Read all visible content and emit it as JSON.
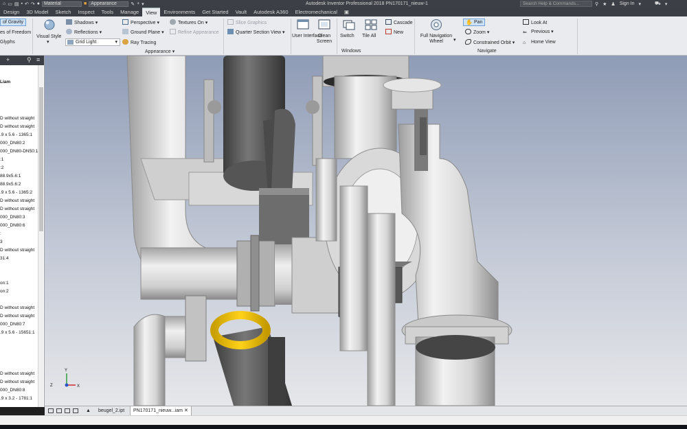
{
  "titlebar": {
    "quickaccess_combo1": "Material",
    "quickaccess_combo2": "Appearance",
    "title": "Autodesk Inventor Professional 2018    PN170171_nieuw-1",
    "search_placeholder": "Search Help & Commands...",
    "sign_in": "Sign In"
  },
  "tabs": [
    "Design",
    "3D Model",
    "Sketch",
    "Inspect",
    "Tools",
    "Manage",
    "View",
    "Environments",
    "Get Started",
    "Vault",
    "Autodesk A360",
    "Electromechanical"
  ],
  "active_tab": "View",
  "ribbon": {
    "visibility": {
      "center_of_gravity": "of Gravity",
      "dof": "es of Freedom",
      "glyphs": "Glyphs"
    },
    "appearance": {
      "visual_style": "Visual Style",
      "shadows": "Shadows",
      "reflections": "Reflections",
      "grid_light": "Grid Light",
      "perspective": "Perspective",
      "ground_plane": "Ground Plane",
      "ray_tracing": "Ray Tracing",
      "textures_on": "Textures On",
      "refine_appearance": "Refine Appearance",
      "slice_graphics": "Slice Graphics",
      "quarter_section_view": "Quarter Section View",
      "panel_label": "Appearance"
    },
    "windows": {
      "user_interface": "User Interface",
      "clean_screen": "Clean Screen",
      "switch": "Switch",
      "tile_all": "Tile All",
      "cascade": "Cascade",
      "new": "New",
      "panel_label": "Windows"
    },
    "navigate": {
      "full_navigation_wheel": "Full Navigation Wheel",
      "pan": "Pan",
      "zoom": "Zoom",
      "constrained_orbit": "Constrained Orbit",
      "look_at": "Look At",
      "previous": "Previous",
      "home_view": "Home View",
      "panel_label": "Navigate"
    }
  },
  "browser": {
    "root": "Liam",
    "rows": [
      "D without straight",
      "D without straight",
      ".9 x 5.6 - 1365:1",
      "000_DN80:2",
      "000_DN80-DN50:1",
      ":1",
      ":2",
      "88.9x5.6:1",
      "88.9x5.6:2",
      ".9 x 5.6 - 1365:2",
      "D without straight",
      "D without straight",
      "000_DN80:3",
      "000_DN80:6",
      ":",
      "3",
      "D without straight",
      "31:4",
      "",
      "",
      "on:1",
      "on:2",
      "",
      "D without straight",
      "D without straight",
      "000_DN80:7",
      ".9 x 5.6 - 15651:1",
      "",
      "",
      "",
      "",
      "D without straight",
      "D without straight",
      "000_DN80:8",
      ".9 x 3.2 - 1781:1"
    ]
  },
  "triad": {
    "x": "X",
    "y": "Y",
    "z": "Z"
  },
  "doctabs": [
    "beugel_2.ipt",
    "PN170171_nieuw...iam"
  ]
}
